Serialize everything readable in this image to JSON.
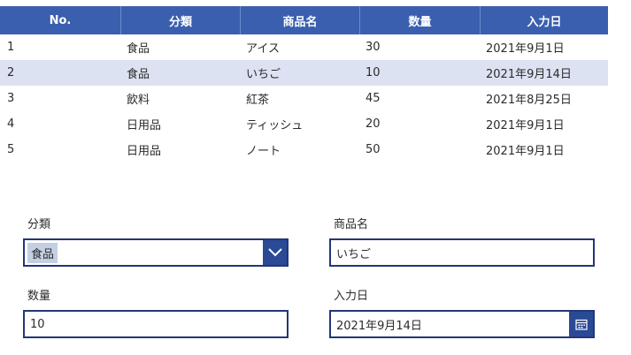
{
  "table": {
    "headers": [
      "No.",
      "分類",
      "商品名",
      "数量",
      "入力日"
    ],
    "rows": [
      {
        "no": "1",
        "category": "食品",
        "product": "アイス",
        "qty": "30",
        "date": "2021年9月1日"
      },
      {
        "no": "2",
        "category": "食品",
        "product": "いちご",
        "qty": "10",
        "date": "2021年9月14日"
      },
      {
        "no": "3",
        "category": "飲料",
        "product": "紅茶",
        "qty": "45",
        "date": "2021年8月25日"
      },
      {
        "no": "4",
        "category": "日用品",
        "product": "ティッシュ",
        "qty": "20",
        "date": "2021年9月1日"
      },
      {
        "no": "5",
        "category": "日用品",
        "product": "ノート",
        "qty": "50",
        "date": "2021年9月1日"
      }
    ],
    "selected_row": 2
  },
  "form": {
    "category_label": "分類",
    "category_value": "食品",
    "product_label": "商品名",
    "product_value": "いちご",
    "qty_label": "数量",
    "qty_value": "10",
    "date_label": "入力日",
    "date_value": "2021年9月14日"
  },
  "icons": {
    "dropdown": "chevron-down-icon",
    "date": "calendar-icon"
  },
  "colors": {
    "header_bg": "#3a5fae",
    "selected_row_bg": "#dce2f2",
    "input_border": "#23367a",
    "button_bg": "#2a4a96"
  }
}
